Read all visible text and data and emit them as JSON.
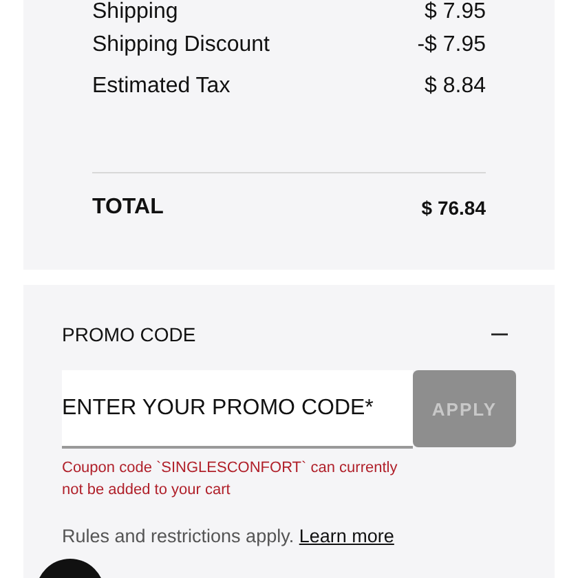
{
  "summary": {
    "rows": [
      {
        "label": "Shipping",
        "value": "$ 7.95"
      },
      {
        "label": "Shipping Discount",
        "value": "-$ 7.95"
      },
      {
        "label": "Estimated Tax",
        "value": "$ 8.84"
      }
    ],
    "total": {
      "label": "TOTAL",
      "value": "$ 76.84"
    }
  },
  "promo": {
    "title": "PROMO CODE",
    "expanded": true,
    "field": {
      "placeholder": "ENTER YOUR PROMO CODE*"
    },
    "apply": {
      "label": "APPLY",
      "disabled": true
    },
    "error": "Coupon code `SINGLESCONFORT` can currently not be added to your cart",
    "rules": "Rules and restrictions apply.",
    "link": "Learn more"
  }
}
